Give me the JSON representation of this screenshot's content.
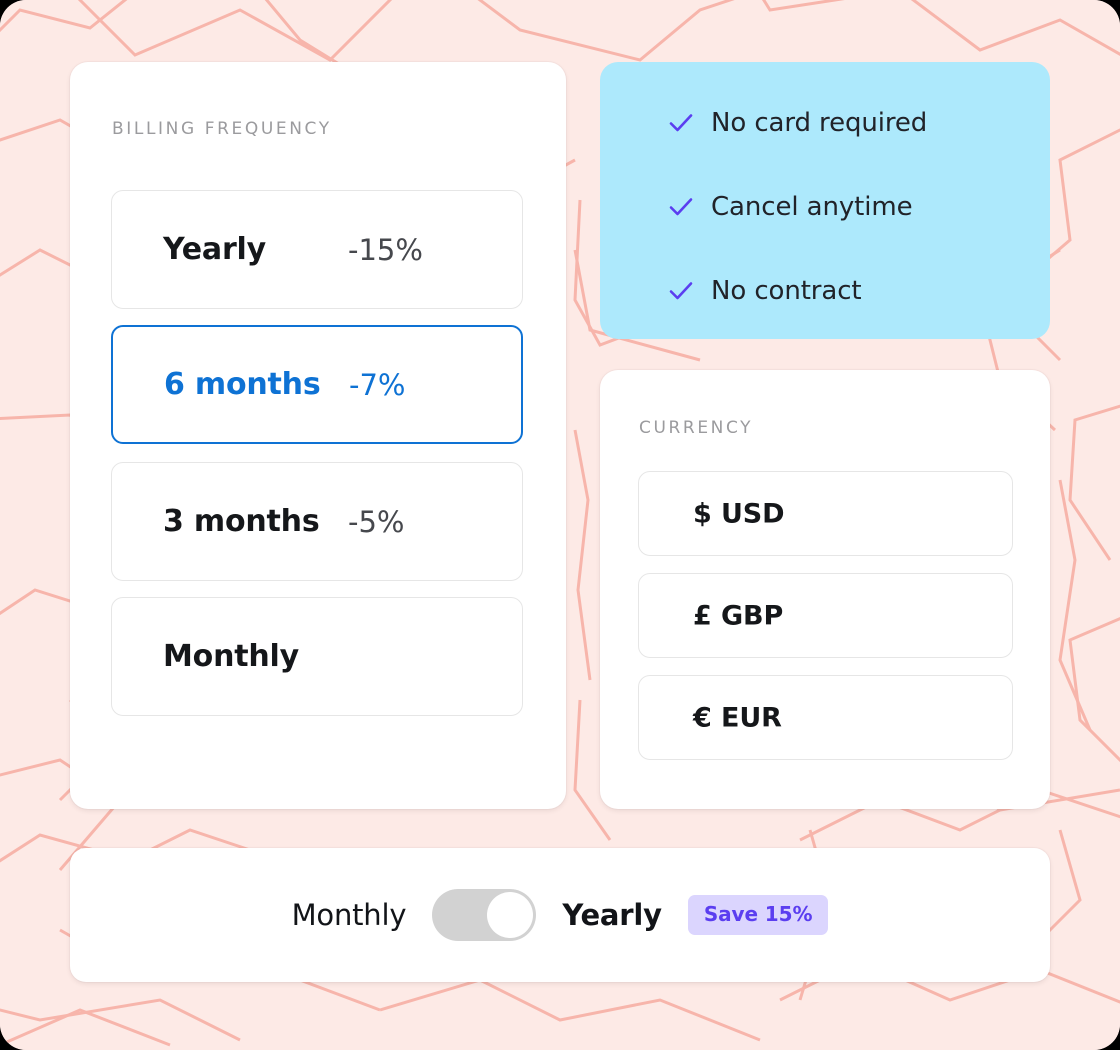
{
  "theme": {
    "page_background": "#fdeae6",
    "pattern_line_color": "#f7b8ae",
    "card_background": "#ffffff",
    "accent_blue": "#0e72d4",
    "perks_background": "#ade9fc",
    "check_color": "#5b3ef0",
    "badge_background": "#dbd5fe",
    "badge_text_color": "#5b3ef0",
    "muted_label_color": "#9b9b9e",
    "toggle_track_color": "#d2d2d2"
  },
  "billing": {
    "label": "BILLING FREQUENCY",
    "options": [
      {
        "name": "Yearly",
        "discount": "-15%",
        "selected": false
      },
      {
        "name": "6 months",
        "discount": "-7%",
        "selected": true
      },
      {
        "name": "3 months",
        "discount": "-5%",
        "selected": false
      },
      {
        "name": "Monthly",
        "discount": "",
        "selected": false
      }
    ]
  },
  "perks": {
    "items": [
      {
        "icon": "check-icon",
        "text": "No card required"
      },
      {
        "icon": "check-icon",
        "text": "Cancel anytime"
      },
      {
        "icon": "check-icon",
        "text": "No contract"
      }
    ]
  },
  "currency": {
    "label": "CURRENCY",
    "options": [
      {
        "symbol": "$",
        "code": "USD",
        "text": "$ USD",
        "selected": false
      },
      {
        "symbol": "£",
        "code": "GBP",
        "text": "£ GBP",
        "selected": false
      },
      {
        "symbol": "€",
        "code": "EUR",
        "text": "€ EUR",
        "selected": false
      }
    ]
  },
  "toggle": {
    "left_label": "Monthly",
    "right_label": "Yearly",
    "state": "yearly",
    "badge_label": "Save 15%"
  }
}
